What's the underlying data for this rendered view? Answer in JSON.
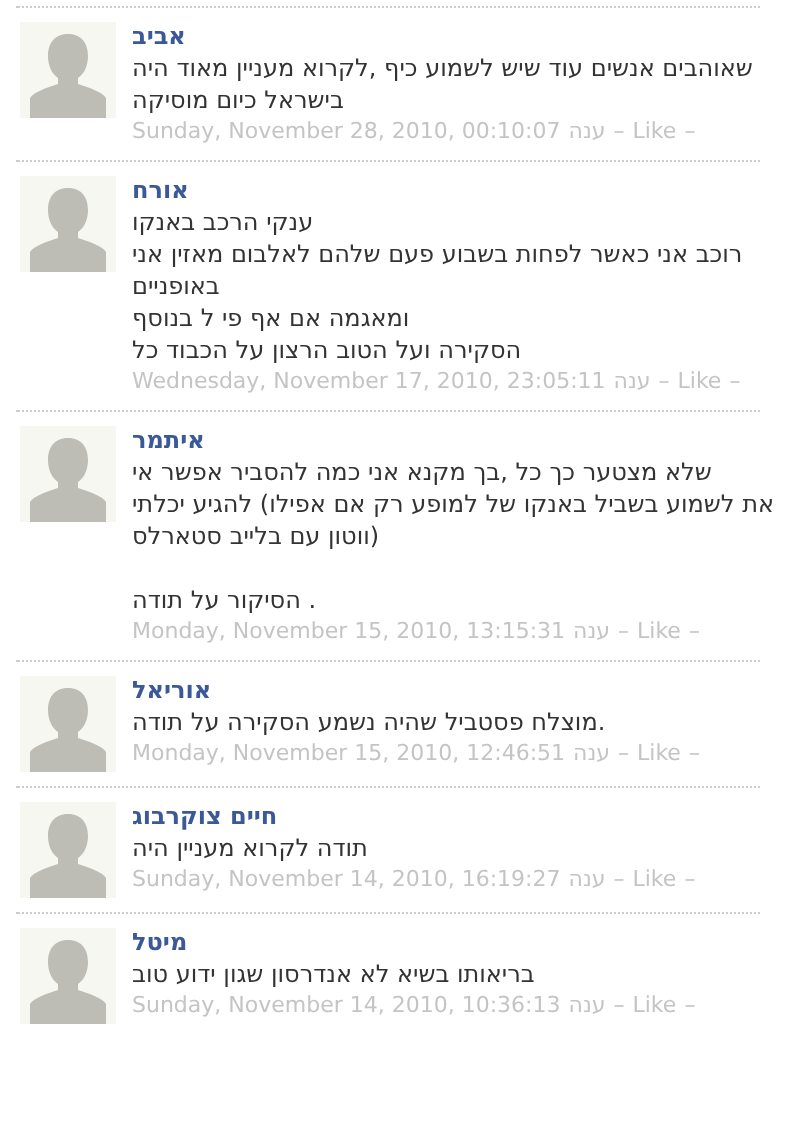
{
  "comments": [
    {
      "author": "אביב",
      "paragraphs": [
        [
          "היה מאוד מעניין לקרוא, כיף לשמוע שיש עוד אנשים שאוהבים",
          "מוסיקה כיום בישראל"
        ]
      ],
      "date": "Sunday, November 28, 2010, 00:10:07",
      "reply": "ענה",
      "sep1": "–",
      "like": "Like",
      "sep2": "–"
    },
    {
      "author": "אורח",
      "paragraphs": [
        [
          "באנקו הרכב ענקי",
          "אני מאזין לאלבום שלהם פעם בשבוע לפחות כאשר אני רוכב",
          "באופניים",
          "בנוסף ל פי אף אם ומאגמה",
          "כל הכבוד על הרצון הטוב ועל הסקירה"
        ]
      ],
      "date": "Wednesday, November 17, 2010, 23:05:11",
      "reply": "ענה",
      "sep1": "–",
      "like": "Like",
      "sep2": "–"
    },
    {
      "author": "איתמר",
      "paragraphs": [
        [
          "אי אפשר להסביר כמה אני מקנא בך, כל כך מצטער שלא",
          "יכלתי להגיע (אפילו אם רק למופע של באנקו בשביל לשמוע את",
          "סטארלס בלייב עם ווטון)"
        ],
        [
          "תודה על הסיקור ."
        ]
      ],
      "date": "Monday, November 15, 2010, 13:15:31",
      "reply": "ענה",
      "sep1": "–",
      "like": "Like",
      "sep2": "–"
    },
    {
      "author": "אוריאל",
      "paragraphs": [
        [
          "תודה על הסקירה נשמע שהיה פסטביל מוצלח."
        ]
      ],
      "date": "Monday, November 15, 2010, 12:46:51",
      "reply": "ענה",
      "sep1": "–",
      "like": "Like",
      "sep2": "–"
    },
    {
      "author": "חיים צוקרבוג",
      "paragraphs": [
        [
          "היה מעניין לקרוא תודה"
        ]
      ],
      "date": "Sunday, November 14, 2010, 16:19:27",
      "reply": "ענה",
      "sep1": "–",
      "like": "Like",
      "sep2": "–"
    },
    {
      "author": "מיטל",
      "paragraphs": [
        [
          "טוב ידוע שגון אנדרסון לא בשיא בריאותו"
        ]
      ],
      "date": "Sunday, November 14, 2010, 10:36:13",
      "reply": "ענה",
      "sep1": "–",
      "like": "Like",
      "sep2": "–"
    }
  ]
}
